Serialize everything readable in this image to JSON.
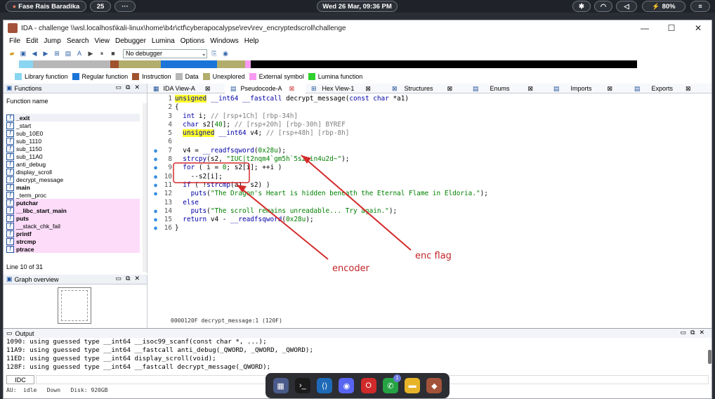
{
  "os_bar": {
    "user": "Fase Rais Baradika",
    "notif_count": "25",
    "more": "···",
    "datetime": "Wed 26 Mar, 09:36 PM",
    "battery": "80%"
  },
  "window": {
    "title": "IDA - challenge \\\\wsl.localhost\\kali-linux\\home\\b4r\\ctf\\cyberapocalypse\\rev\\rev_encryptedscroll\\challenge"
  },
  "menu": [
    "File",
    "Edit",
    "Jump",
    "Search",
    "View",
    "Debugger",
    "Lumina",
    "Options",
    "Windows",
    "Help"
  ],
  "toolbar": {
    "debugger": "No debugger"
  },
  "legend": [
    {
      "label": "Library function",
      "color": "#8ad6f2"
    },
    {
      "label": "Regular function",
      "color": "#1b75d8"
    },
    {
      "label": "Instruction",
      "color": "#a0522d"
    },
    {
      "label": "Data",
      "color": "#b7b7b7"
    },
    {
      "label": "Unexplored",
      "color": "#b3ad6d"
    },
    {
      "label": "External symbol",
      "color": "#f79bf2"
    },
    {
      "label": "Lumina function",
      "color": "#2fd02f"
    }
  ],
  "functions": {
    "title": "Functions",
    "column": "Function name",
    "items": [
      "_exit",
      "_start",
      "sub_10E0",
      "sub_1110",
      "sub_1150",
      "sub_11A0",
      "anti_debug",
      "display_scroll",
      "decrypt_message",
      "main",
      "_term_proc",
      "putchar",
      "__libc_start_main",
      "puts",
      "__stack_chk_fail",
      "printf",
      "strcmp",
      "ptrace"
    ],
    "status": "Line 10 of 31"
  },
  "graph": {
    "title": "Graph overview"
  },
  "tabs": [
    "IDA View-A",
    "Pseudocode-A",
    "Hex View-1",
    "Structures",
    "Enums",
    "Imports",
    "Exports"
  ],
  "code": {
    "lines": [
      {
        "n": "1",
        "dot": false
      },
      {
        "n": "2",
        "dot": false
      },
      {
        "n": "3",
        "dot": false
      },
      {
        "n": "4",
        "dot": false
      },
      {
        "n": "5",
        "dot": false
      },
      {
        "n": "6",
        "dot": false
      },
      {
        "n": "7",
        "dot": true
      },
      {
        "n": "8",
        "dot": true
      },
      {
        "n": "9",
        "dot": true
      },
      {
        "n": "10",
        "dot": true
      },
      {
        "n": "11",
        "dot": true
      },
      {
        "n": "12",
        "dot": true
      },
      {
        "n": "13",
        "dot": false
      },
      {
        "n": "14",
        "dot": true
      },
      {
        "n": "15",
        "dot": true
      },
      {
        "n": "16",
        "dot": true
      }
    ],
    "status": "0000120F decrypt_message:1 (120F)"
  },
  "annotations": {
    "enc_flag": "enc flag",
    "encoder": "encoder"
  },
  "output": {
    "title": "Output",
    "lines": [
      "1090: using guessed type __int64 __isoc99_scanf(const char *, ...);",
      "11A9: using guessed type __int64 __fastcall anti_debug(_QWORD, _QWORD, _QWORD);",
      "11ED: using guessed type __int64 display_scroll(void);",
      "128F: using guessed type __int64 __fastcall decrypt_message(_QWORD);"
    ],
    "idc_button": "IDC",
    "status": "AU:  idle   Down   Disk: 920GB"
  },
  "dock": {
    "badge": "1"
  }
}
